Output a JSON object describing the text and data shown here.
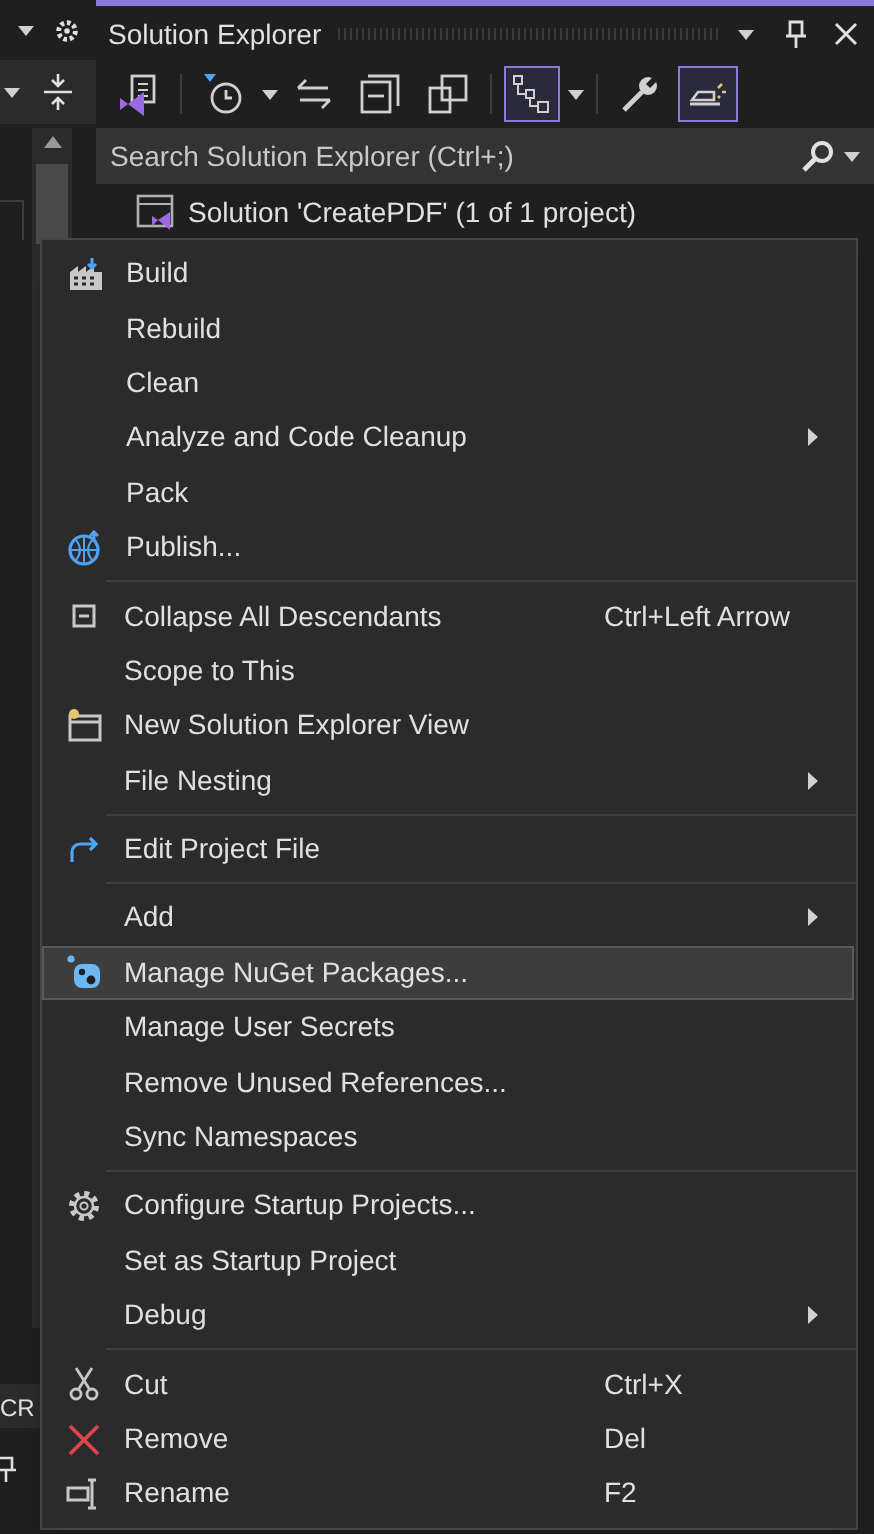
{
  "left_strip": {
    "fragment": "CR"
  },
  "solution_explorer": {
    "title": "Solution Explorer",
    "toolbar": [
      {
        "kind": "vs",
        "on": false,
        "dropdown": false
      },
      {
        "kind": "history",
        "on": false,
        "dropdown": true
      },
      {
        "kind": "sync",
        "on": false,
        "dropdown": false
      },
      {
        "kind": "collapse",
        "on": false,
        "dropdown": false
      },
      {
        "kind": "copies",
        "on": false,
        "dropdown": false
      },
      {
        "kind": "tree",
        "on": true,
        "dropdown": true
      },
      {
        "kind": "wrench",
        "on": false,
        "dropdown": false
      },
      {
        "kind": "preview",
        "on": true,
        "dropdown": false
      }
    ],
    "search": {
      "placeholder": "Search Solution Explorer (Ctrl+;)"
    },
    "tree_root": "Solution 'CreatePDF' (1 of 1 project)"
  },
  "context_menu": {
    "groups": [
      [
        {
          "label": "Build",
          "kind": "build",
          "submenu": false,
          "selected": false
        },
        {
          "label": "Rebuild",
          "kind": "plain",
          "submenu": false,
          "selected": false
        },
        {
          "label": "Clean",
          "kind": "plain",
          "submenu": false,
          "selected": false
        },
        {
          "label": "Analyze and Code Cleanup",
          "kind": "plain",
          "submenu": true,
          "selected": false
        },
        {
          "label": "Pack",
          "kind": "plain",
          "submenu": false,
          "selected": false
        },
        {
          "label": "Publish...",
          "kind": "publish",
          "submenu": false,
          "selected": false
        }
      ],
      [
        {
          "label": "Collapse All Descendants",
          "kind": "collapse",
          "shortcut": "Ctrl+Left Arrow",
          "submenu": false,
          "selected": false
        },
        {
          "label": "Scope to This",
          "kind": "plain",
          "submenu": false,
          "selected": false
        },
        {
          "label": "New Solution Explorer View",
          "kind": "newview",
          "submenu": false,
          "selected": false
        },
        {
          "label": "File Nesting",
          "kind": "plain",
          "submenu": true,
          "selected": false
        }
      ],
      [
        {
          "label": "Edit Project File",
          "kind": "edit",
          "submenu": false,
          "selected": false
        }
      ],
      [
        {
          "label": "Add",
          "kind": "plain",
          "submenu": true,
          "selected": false
        },
        {
          "label": "Manage NuGet Packages...",
          "kind": "nuget",
          "submenu": false,
          "selected": true
        },
        {
          "label": "Manage User Secrets",
          "kind": "plain",
          "submenu": false,
          "selected": false
        },
        {
          "label": "Remove Unused References...",
          "kind": "plain",
          "submenu": false,
          "selected": false
        },
        {
          "label": "Sync Namespaces",
          "kind": "plain",
          "submenu": false,
          "selected": false
        }
      ],
      [
        {
          "label": "Configure Startup Projects...",
          "kind": "gear",
          "submenu": false,
          "selected": false
        },
        {
          "label": "Set as Startup Project",
          "kind": "plain",
          "submenu": false,
          "selected": false
        },
        {
          "label": "Debug",
          "kind": "plain",
          "submenu": true,
          "selected": false
        }
      ],
      [
        {
          "label": "Cut",
          "kind": "cut",
          "shortcut": "Ctrl+X",
          "submenu": false,
          "selected": false
        },
        {
          "label": "Remove",
          "kind": "remove",
          "shortcut": "Del",
          "submenu": false,
          "selected": false
        },
        {
          "label": "Rename",
          "kind": "rename",
          "shortcut": "F2",
          "submenu": false,
          "selected": false
        }
      ]
    ]
  }
}
